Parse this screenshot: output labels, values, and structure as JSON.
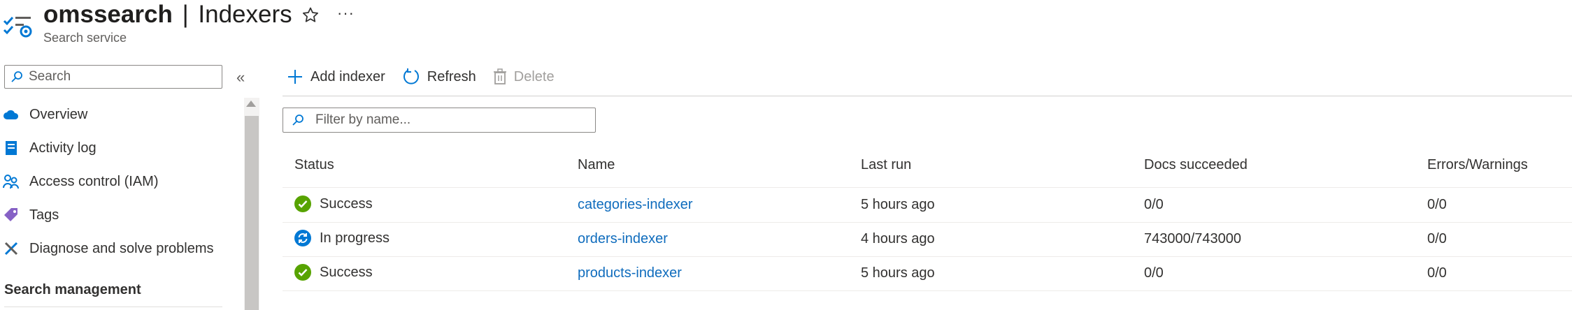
{
  "header": {
    "service_name": "omssearch",
    "separator": "|",
    "page_name": "Indexers",
    "subtitle": "Search service",
    "more_label": "···"
  },
  "sidebar": {
    "search_placeholder": "Search",
    "collapse_label": "«",
    "items": [
      {
        "label": "Overview",
        "icon": "cloud-icon"
      },
      {
        "label": "Activity log",
        "icon": "activity-log-icon"
      },
      {
        "label": "Access control (IAM)",
        "icon": "people-icon"
      },
      {
        "label": "Tags",
        "icon": "tag-icon"
      },
      {
        "label": "Diagnose and solve problems",
        "icon": "wrench-icon"
      }
    ],
    "section_heading": "Search management"
  },
  "toolbar": {
    "add_label": "Add indexer",
    "refresh_label": "Refresh",
    "delete_label": "Delete"
  },
  "filter": {
    "placeholder": "Filter by name..."
  },
  "table": {
    "columns": [
      "Status",
      "Name",
      "Last run",
      "Docs succeeded",
      "Errors/Warnings"
    ],
    "rows": [
      {
        "status": "Success",
        "status_kind": "success",
        "name": "categories-indexer",
        "last_run": "5 hours ago",
        "docs": "0/0",
        "errors": "0/0"
      },
      {
        "status": "In progress",
        "status_kind": "in-progress",
        "name": "orders-indexer",
        "last_run": "4 hours ago",
        "docs": "743000/743000",
        "errors": "0/0"
      },
      {
        "status": "Success",
        "status_kind": "success",
        "name": "products-indexer",
        "last_run": "5 hours ago",
        "docs": "0/0",
        "errors": "0/0"
      }
    ]
  },
  "colors": {
    "accent": "#0f6cbd",
    "success": "#57a300",
    "in_progress": "#0078d4"
  }
}
